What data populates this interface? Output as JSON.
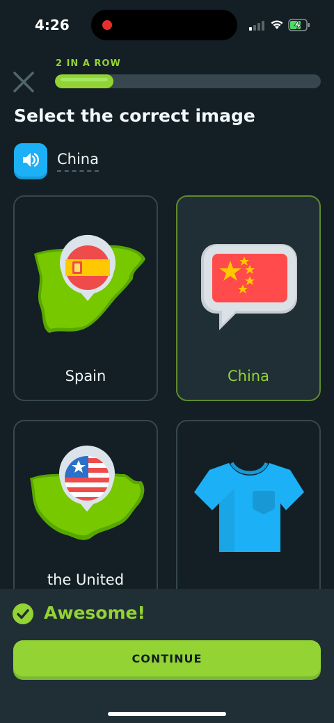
{
  "status_bar": {
    "time": "4:26"
  },
  "header": {
    "streak_label": "2 IN A ROW",
    "progress_fraction": 0.22
  },
  "prompt": {
    "title": "Select the correct image",
    "word": "China"
  },
  "options": [
    {
      "label": "Spain",
      "icon": "spain-map-icon",
      "selected": false
    },
    {
      "label": "China",
      "icon": "china-flag-speech-icon",
      "selected": true
    },
    {
      "label": "the United",
      "icon": "usa-map-icon",
      "selected": false
    },
    {
      "label": "",
      "icon": "t-shirt-icon",
      "selected": false
    }
  ],
  "feedback": {
    "message": "Awesome!",
    "button_label": "CONTINUE"
  },
  "colors": {
    "background": "#131f24",
    "accent_green": "#93d333",
    "accent_blue": "#1cb0f6",
    "panel": "#202f36"
  }
}
